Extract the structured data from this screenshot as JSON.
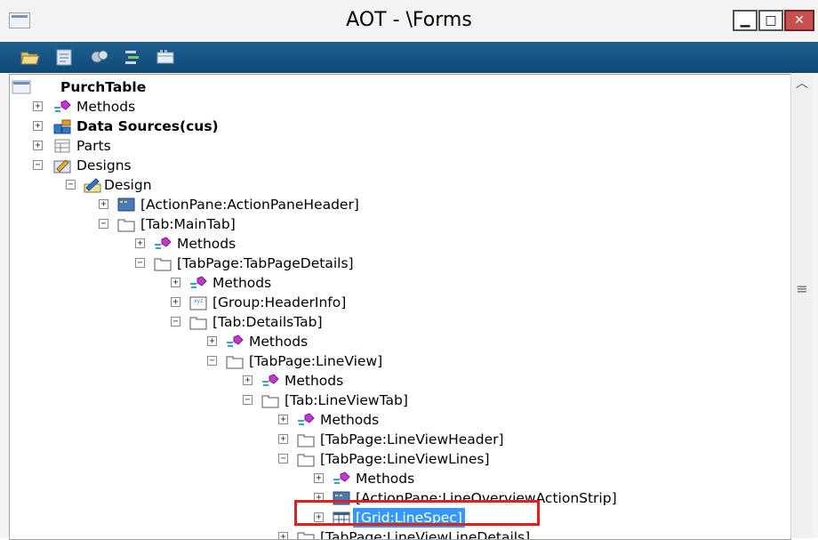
{
  "window": {
    "title": "AOT - \\Forms"
  },
  "caption_buttons": {
    "minimize": "▁",
    "maximize": "□",
    "close": "✕"
  },
  "toolbar": {
    "buttons": [
      {
        "name": "open-icon"
      },
      {
        "name": "properties-icon"
      },
      {
        "name": "compile-icon"
      },
      {
        "name": "sort-icon"
      },
      {
        "name": "layout-icon"
      }
    ]
  },
  "tree": {
    "root": "PurchTable",
    "items": [
      {
        "label": "Methods",
        "icon": "methods-icon",
        "expander": "+"
      },
      {
        "label": "Data Sources(cus)",
        "icon": "datasources-icon",
        "expander": "+"
      },
      {
        "label": "Parts",
        "icon": "parts-icon",
        "expander": "+"
      },
      {
        "label": "Designs",
        "icon": "designs-icon",
        "expander": "−"
      },
      {
        "label": "Design",
        "icon": "design-icon",
        "expander": "−"
      },
      {
        "label": "[ActionPane:ActionPaneHeader]",
        "icon": "actionpane-icon",
        "expander": "+"
      },
      {
        "label": "[Tab:MainTab]",
        "icon": "tab-icon",
        "expander": "−"
      },
      {
        "label": "Methods",
        "icon": "methods-icon",
        "expander": "+"
      },
      {
        "label": "[TabPage:TabPageDetails]",
        "icon": "tabpage-icon",
        "expander": "−"
      },
      {
        "label": "Methods",
        "icon": "methods-icon",
        "expander": "+"
      },
      {
        "label": "[Group:HeaderInfo]",
        "icon": "group-icon",
        "expander": "+"
      },
      {
        "label": "[Tab:DetailsTab]",
        "icon": "tab-icon",
        "expander": "−"
      },
      {
        "label": "Methods",
        "icon": "methods-icon",
        "expander": "+"
      },
      {
        "label": "[TabPage:LineView]",
        "icon": "tabpage-icon",
        "expander": "−"
      },
      {
        "label": "Methods",
        "icon": "methods-icon",
        "expander": "+"
      },
      {
        "label": "[Tab:LineViewTab]",
        "icon": "tab-icon",
        "expander": "−"
      },
      {
        "label": "Methods",
        "icon": "methods-icon",
        "expander": "+"
      },
      {
        "label": "[TabPage:LineViewHeader]",
        "icon": "tabpage-icon",
        "expander": "+"
      },
      {
        "label": "[TabPage:LineViewLines]",
        "icon": "tabpage-icon",
        "expander": "−"
      },
      {
        "label": "Methods",
        "icon": "methods-icon",
        "expander": "+"
      },
      {
        "label": "[ActionPane:LineOverviewActionStrip]",
        "icon": "actionpane-icon",
        "expander": "+"
      },
      {
        "label": "[Grid:LineSpec]",
        "icon": "grid-icon",
        "expander": "+"
      },
      {
        "label": "[TabPage:LineViewLineDetails]",
        "icon": "tabpage-icon",
        "expander": "+"
      }
    ]
  },
  "scrollbar": {
    "up": "︿",
    "grip": "≡"
  }
}
